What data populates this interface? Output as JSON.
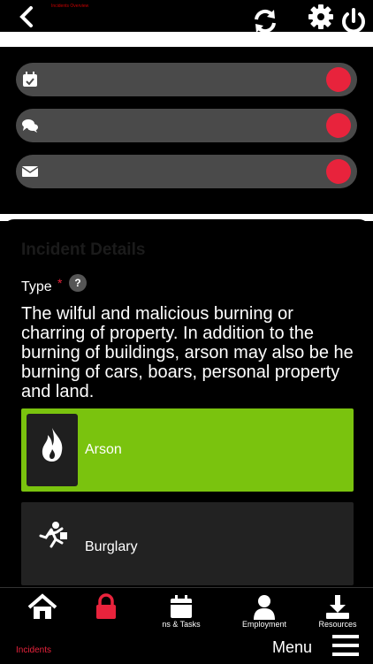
{
  "header": {
    "tiny_label": "Incidents Overview",
    "icons": [
      "back-chevron-icon",
      "sync-icon",
      "gear-icon",
      "power-icon"
    ]
  },
  "status_pills": [
    {
      "icon": "calendar-check-icon",
      "indicator": "red-dot"
    },
    {
      "icon": "chat-bubbles-icon",
      "indicator": "red-dot"
    },
    {
      "icon": "envelope-icon",
      "indicator": "red-dot"
    }
  ],
  "incident": {
    "title": "Incident Details",
    "type_label": "Type",
    "required_mark": "*",
    "help": "?",
    "description": "The wilful and malicious burning or charring of property. In addition to the burning of buildings, arson may also be he burning of cars, boars, personal property and land.",
    "options": [
      {
        "label": "Arson",
        "icon": "fire-icon",
        "selected": true
      },
      {
        "label": "Burglary",
        "icon": "burglar-running-icon",
        "selected": false
      }
    ]
  },
  "bottom_nav": {
    "items": [
      {
        "label": "",
        "icon": "home-icon"
      },
      {
        "label": "",
        "icon": "lock-icon"
      },
      {
        "label": "ns & Tasks",
        "icon": "calendar-icon"
      },
      {
        "label": "Employment",
        "icon": "person-icon"
      },
      {
        "label": "Resources",
        "icon": "download-icon"
      }
    ],
    "active_label": "Incidents",
    "menu_label": "Menu"
  },
  "colors": {
    "accent_green": "#7ac30e",
    "alert_red": "#e8233c",
    "pill_gray": "#4a4a4a"
  }
}
